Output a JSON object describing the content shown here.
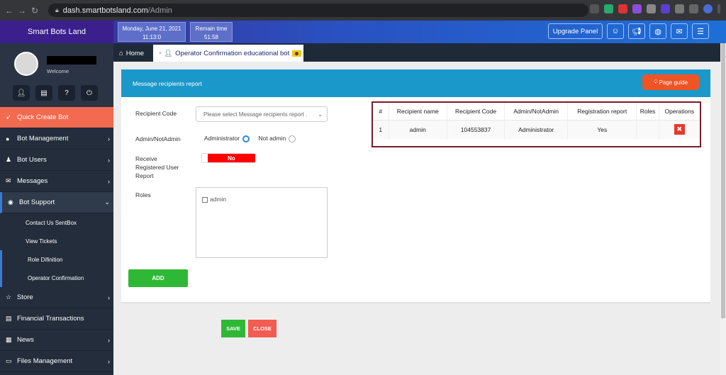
{
  "browser": {
    "host": "dash.smartbotsland.com",
    "path": "/Admin"
  },
  "header": {
    "brand": "Smart Bots Land",
    "date": "Monday, June 21, 2021",
    "time": "11:13:0",
    "remain_label": "Remain time",
    "remain_value": "51:58",
    "upgrade": "Upgrade Panel"
  },
  "sidebar": {
    "welcome": "Welcome",
    "quick": "Quick Create Bot",
    "items": [
      "Bot Management",
      "Bot Users",
      "Messages",
      "Bot Support"
    ],
    "subitems": [
      "Contact Us SentBox",
      "View Tickets",
      "Role Difinition",
      "Operator Confirmation"
    ],
    "more": [
      "Store",
      "Financial Transactions",
      "News",
      "Files Management"
    ]
  },
  "tabs": {
    "home": "Home",
    "active": "Operator Confirmation educational bot"
  },
  "panel": {
    "title": "Message recipients report",
    "guide": "Page guide",
    "recipient_code_label": "Recipient Code",
    "recipient_code_placeholder": "Please select Message recipients report .",
    "admin_label": "Admin/NotAdmin",
    "opt_admin": "Administrator",
    "opt_notadmin": "Not admin",
    "receive_label_1": "Receive",
    "receive_label_2": "Registered User",
    "receive_label_3": "Report",
    "toggle_value": "No",
    "roles_label": "Roles",
    "role_option": "admin",
    "add": "ADD"
  },
  "table": {
    "headers": [
      "#",
      "Recipient name",
      "Recipient Code",
      "Admin/NotAdmin",
      "Registration report",
      "Roles",
      "Operations"
    ],
    "rows": [
      [
        "1",
        "admin",
        "104553837",
        "Administrator",
        "Yes",
        ""
      ]
    ]
  },
  "footer": {
    "save": "SAVE",
    "close": "CLOSE"
  },
  "colors": {
    "header_start": "#3d2a8f",
    "header_end": "#1e6fd8",
    "panel_head": "#1a98c9",
    "quick": "#f26a4f",
    "add": "#2fb836",
    "close": "#f25c52",
    "highlight": "#7a1c2a"
  }
}
